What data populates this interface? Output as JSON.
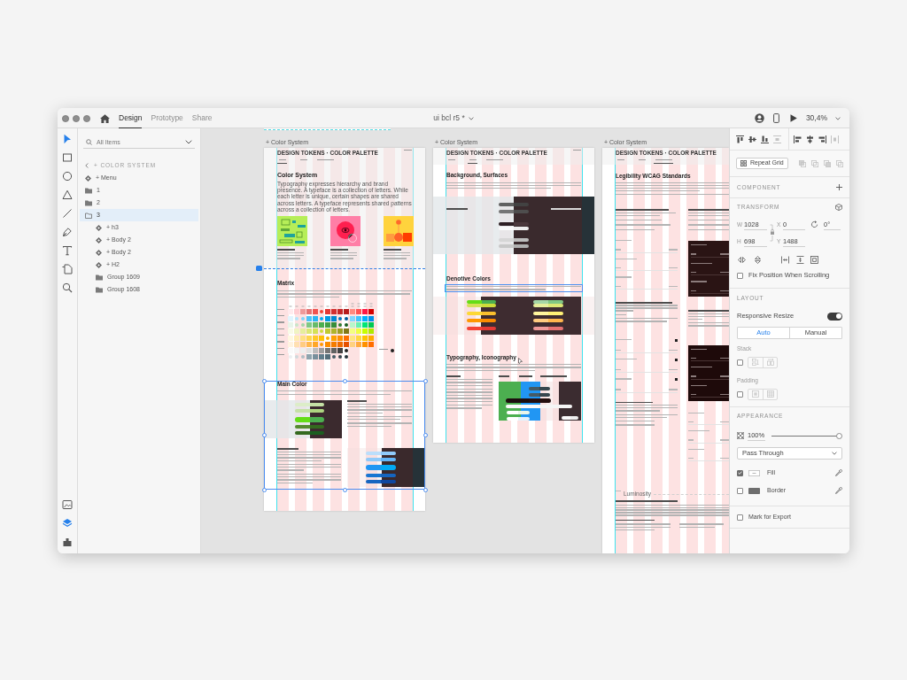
{
  "window": {
    "title": "ui bcl r5 *",
    "mode_tabs": [
      {
        "label": "Design",
        "selected": true
      },
      {
        "label": "Prototype",
        "selected": false
      },
      {
        "label": "Share",
        "selected": false
      }
    ],
    "zoom": "30,4%"
  },
  "tools": [
    {
      "kind": "select",
      "selected": true
    },
    {
      "kind": "rectangle",
      "selected": false
    },
    {
      "kind": "ellipse",
      "selected": false
    },
    {
      "kind": "polygon",
      "selected": false
    },
    {
      "kind": "line",
      "selected": false
    },
    {
      "kind": "pen",
      "selected": false
    },
    {
      "kind": "text",
      "selected": false
    },
    {
      "kind": "artboard",
      "selected": false
    },
    {
      "kind": "zoom",
      "selected": false
    }
  ],
  "panel_toggles": [
    {
      "kind": "assets",
      "selected": false
    },
    {
      "kind": "layers",
      "selected": true
    },
    {
      "kind": "plugins",
      "selected": false
    }
  ],
  "layers": {
    "search": {
      "placeholder": "All Items"
    },
    "breadcrumb": "+ COLOR SYSTEM",
    "items": [
      {
        "kind": "component",
        "label": "+ Menu",
        "selected": false
      },
      {
        "kind": "group",
        "label": "1",
        "selected": false,
        "expanded": false
      },
      {
        "kind": "group",
        "label": "2",
        "selected": false,
        "expanded": false
      },
      {
        "kind": "group",
        "label": "3",
        "selected": true,
        "expanded": true,
        "children": [
          {
            "kind": "component",
            "label": "+ h3",
            "selected": false
          },
          {
            "kind": "component",
            "label": "+ Body 2",
            "selected": false
          },
          {
            "kind": "component",
            "label": "+ Body 2",
            "selected": false
          },
          {
            "kind": "component",
            "label": "+ H2",
            "selected": false
          },
          {
            "kind": "group",
            "label": "Group 1609",
            "selected": false,
            "expanded": false
          },
          {
            "kind": "group",
            "label": "Group 1608",
            "selected": false,
            "expanded": false
          }
        ]
      }
    ]
  },
  "artboards": [
    {
      "label": "+ Color System",
      "brand": "DESIGN TOKENS · COLOR PALETTE",
      "tabs": [
        {
          "selected": true
        },
        {
          "selected": false
        },
        {
          "selected": false
        }
      ],
      "fold_marker": true,
      "sections": [
        {
          "kind": "intro",
          "heading": "Color System",
          "text": "Typography expresses hierarchy and brand presence. A typeface is a collection of letters. While each letter is unique, certain shapes are shared across letters. A typeface represents shared patterns across a collection of letters.",
          "selected": false,
          "hovered": false
        },
        {
          "kind": "matrix",
          "heading": "Matrix",
          "selected": false,
          "hovered": false
        },
        {
          "kind": "main-color",
          "heading": "Main Color",
          "selected": true,
          "hovered": false
        }
      ]
    },
    {
      "label": "+ Color System",
      "brand": "DESIGN TOKENS · COLOR PALETTE",
      "tabs": [
        {
          "selected": false
        },
        {
          "selected": true
        },
        {
          "selected": false
        }
      ],
      "fold_marker": false,
      "sections": [
        {
          "kind": "surfaces",
          "heading": "Background, Surfaces",
          "selected": false,
          "hovered": false
        },
        {
          "kind": "denotive",
          "heading": "Denotive Colors",
          "selected": false,
          "hovered": true
        },
        {
          "kind": "typography",
          "heading": "Typography, Iconography",
          "selected": false,
          "hovered": false
        }
      ]
    },
    {
      "label": "+ Color System",
      "brand": "DESIGN TOKENS · COLOR PALETTE",
      "tabs": [
        {
          "selected": false
        },
        {
          "selected": false
        },
        {
          "selected": true
        }
      ],
      "fold_marker": false,
      "sections": [
        {
          "kind": "legibility",
          "heading": "Legibility WCAG Standards",
          "selected": false,
          "hovered": false
        },
        {
          "kind": "luminosity",
          "heading": "Luminosity",
          "selected": false,
          "hovered": false
        }
      ]
    }
  ],
  "inspector": {
    "repeat_grid": "Repeat Grid",
    "component": {
      "heading": "COMPONENT"
    },
    "transform": {
      "heading": "TRANSFORM",
      "fields": [
        {
          "kind": "labeled",
          "label": "W",
          "value": "1028"
        },
        {
          "kind": "labeled",
          "label": "X",
          "value": "0"
        },
        {
          "kind": "rotation",
          "value": "0°"
        },
        {
          "kind": "labeled",
          "label": "H",
          "value": "698"
        },
        {
          "kind": "labeled",
          "label": "Y",
          "value": "1488"
        }
      ],
      "fix_position": {
        "label": "Fix Position When Scrolling",
        "checked": false
      }
    },
    "layout": {
      "heading": "LAYOUT",
      "responsive_resize": {
        "label": "Responsive Resize",
        "on": true
      },
      "modes": [
        {
          "label": "Auto",
          "selected": true
        },
        {
          "label": "Manual",
          "selected": false
        }
      ],
      "stack": {
        "label": "Stack",
        "checked": false
      },
      "padding": {
        "label": "Padding",
        "checked": false
      }
    },
    "appearance": {
      "heading": "APPEARANCE",
      "opacity": {
        "value": "100%",
        "level": 1
      },
      "blend_mode": {
        "value": "Pass Through"
      },
      "fill": {
        "label": "Fill",
        "checked": true
      },
      "border": {
        "label": "Border",
        "checked": false
      }
    },
    "mark_for_export": {
      "label": "Mark for Export",
      "checked": false
    }
  }
}
